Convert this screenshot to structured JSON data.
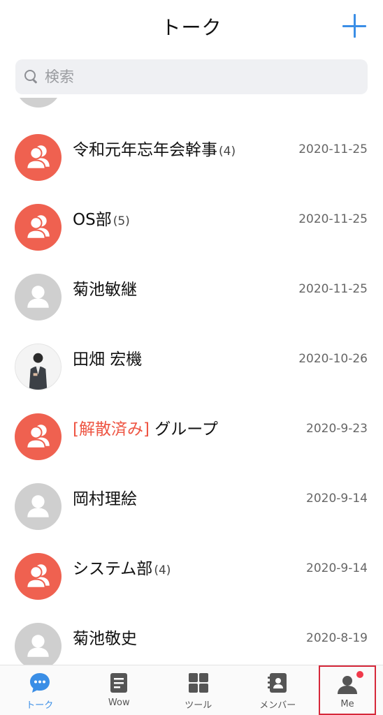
{
  "header": {
    "title": "トーク",
    "add_icon": "plus-icon",
    "accent": "#3a8ee6"
  },
  "search": {
    "placeholder": "検索"
  },
  "chats": [
    {
      "name": "令和元年忘年会幹事",
      "count": "(4)",
      "date": "2020-11-25",
      "avatar": "group"
    },
    {
      "name": "OS部",
      "count": "(5)",
      "date": "2020-11-25",
      "avatar": "group"
    },
    {
      "name": "菊池敏継",
      "count": "",
      "date": "2020-11-25",
      "avatar": "person"
    },
    {
      "name": "田畑 宏機",
      "count": "",
      "date": "2020-10-26",
      "avatar": "photo"
    },
    {
      "tag": "[解散済み]",
      "name": " グループ",
      "count": "",
      "date": "2020-9-23",
      "avatar": "group"
    },
    {
      "name": "岡村理絵",
      "count": "",
      "date": "2020-9-14",
      "avatar": "person"
    },
    {
      "name": "システム部",
      "count": "(4)",
      "date": "2020-9-14",
      "avatar": "group"
    },
    {
      "name": "菊池敬史",
      "count": "",
      "date": "2020-8-19",
      "avatar": "person"
    }
  ],
  "tabs": [
    {
      "label": "トーク",
      "icon": "chat-bubble-icon",
      "active": true
    },
    {
      "label": "Wow",
      "icon": "document-icon"
    },
    {
      "label": "ツール",
      "icon": "grid-icon"
    },
    {
      "label": "メンバー",
      "icon": "contacts-icon"
    },
    {
      "label": "Me",
      "icon": "user-icon",
      "badge": true
    }
  ],
  "colors": {
    "group_avatar": "#ef6150",
    "person_avatar": "#cfcfcf",
    "badge": "#f0394a",
    "tag_red": "#ee5543"
  }
}
